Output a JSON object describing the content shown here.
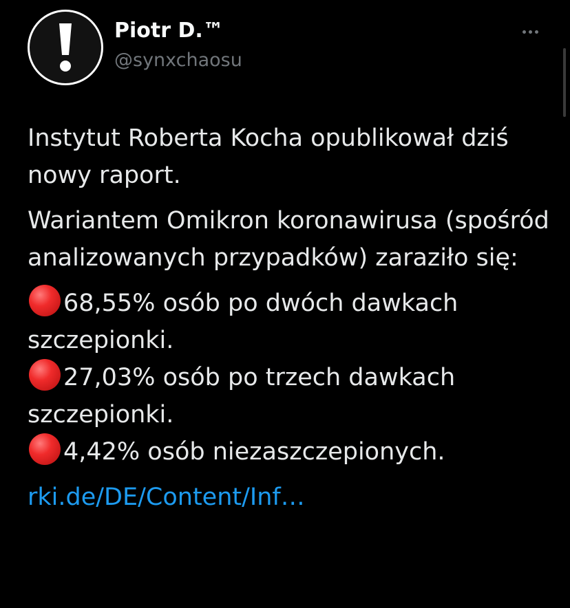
{
  "author": {
    "display_name": "Piotr D.™",
    "handle": "@synxchaosu",
    "avatar_icon": "exclamation-icon"
  },
  "tweet": {
    "paragraph1": "Instytut Roberta Kocha opublikował dziś nowy raport.",
    "paragraph2": "Wariantem Omikron koronawirusa (spośród analizowanych przypadków) zaraziło się:",
    "bullets": [
      {
        "icon": "red-circle-icon",
        "text": "68,55% osób po dwóch dawkach szczepionki."
      },
      {
        "icon": "red-circle-icon",
        "text": "27,03% osób po trzech dawkach szczepionki."
      },
      {
        "icon": "red-circle-icon",
        "text": "4,42% osób niezaszczepionych."
      }
    ],
    "link_text": "rki.de/DE/Content/Inf…"
  },
  "menu": {
    "more_icon": "more-horizontal-icon"
  },
  "colors": {
    "background": "#000000",
    "text": "#e7e9ea",
    "secondary_text": "#71767b",
    "link": "#1d9bf0",
    "bullet_red": "#f02b2b"
  }
}
